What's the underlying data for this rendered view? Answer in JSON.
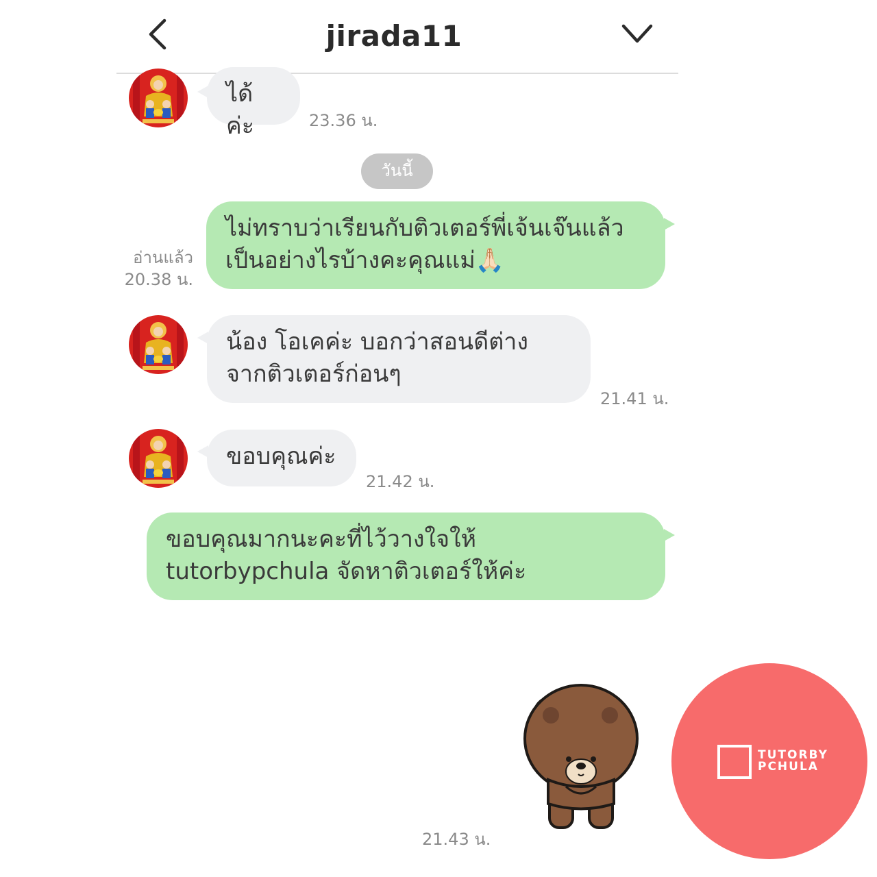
{
  "header": {
    "title": "jirada11",
    "back_icon": "chevron-left-icon",
    "menu_icon": "chevron-down-icon"
  },
  "date_separator": "วันนี้",
  "messages": [
    {
      "side": "in",
      "text": "ได้ค่ะ",
      "time": "23.36 น."
    },
    {
      "side": "out",
      "lines": [
        "ไม่ทราบว่าเรียนกับติวเตอร์พี่เจ้นเจ๊นแล้ว",
        "เป็นอย่างไรบ้างคะคุณแม่🙏🏻"
      ],
      "read": "อ่านแล้ว",
      "time": "20.38 น."
    },
    {
      "side": "in",
      "lines": [
        "น้อง โอเคค่ะ บอกว่าสอนดีต่าง",
        "จากติวเตอร์ก่อนๆ"
      ],
      "time": "21.41 น."
    },
    {
      "side": "in",
      "text": "ขอบคุณค่ะ",
      "time": "21.42 น."
    },
    {
      "side": "out",
      "lines": [
        "ขอบคุณมากนะคะที่ไว้วางใจให้",
        "tutorbypchula จัดหาติวเตอร์ให้ค่ะ"
      ]
    },
    {
      "side": "out",
      "sticker": "bear-bow-sticker",
      "time": "21.43 น."
    }
  ],
  "watermark": {
    "line1": "TUTORBY",
    "line2": "PCHULA",
    "color": "#f76b6b"
  },
  "colors": {
    "incoming_bubble": "#eff0f2",
    "outgoing_bubble": "#b5e9b3",
    "date_pill": "#c6c6c6"
  }
}
